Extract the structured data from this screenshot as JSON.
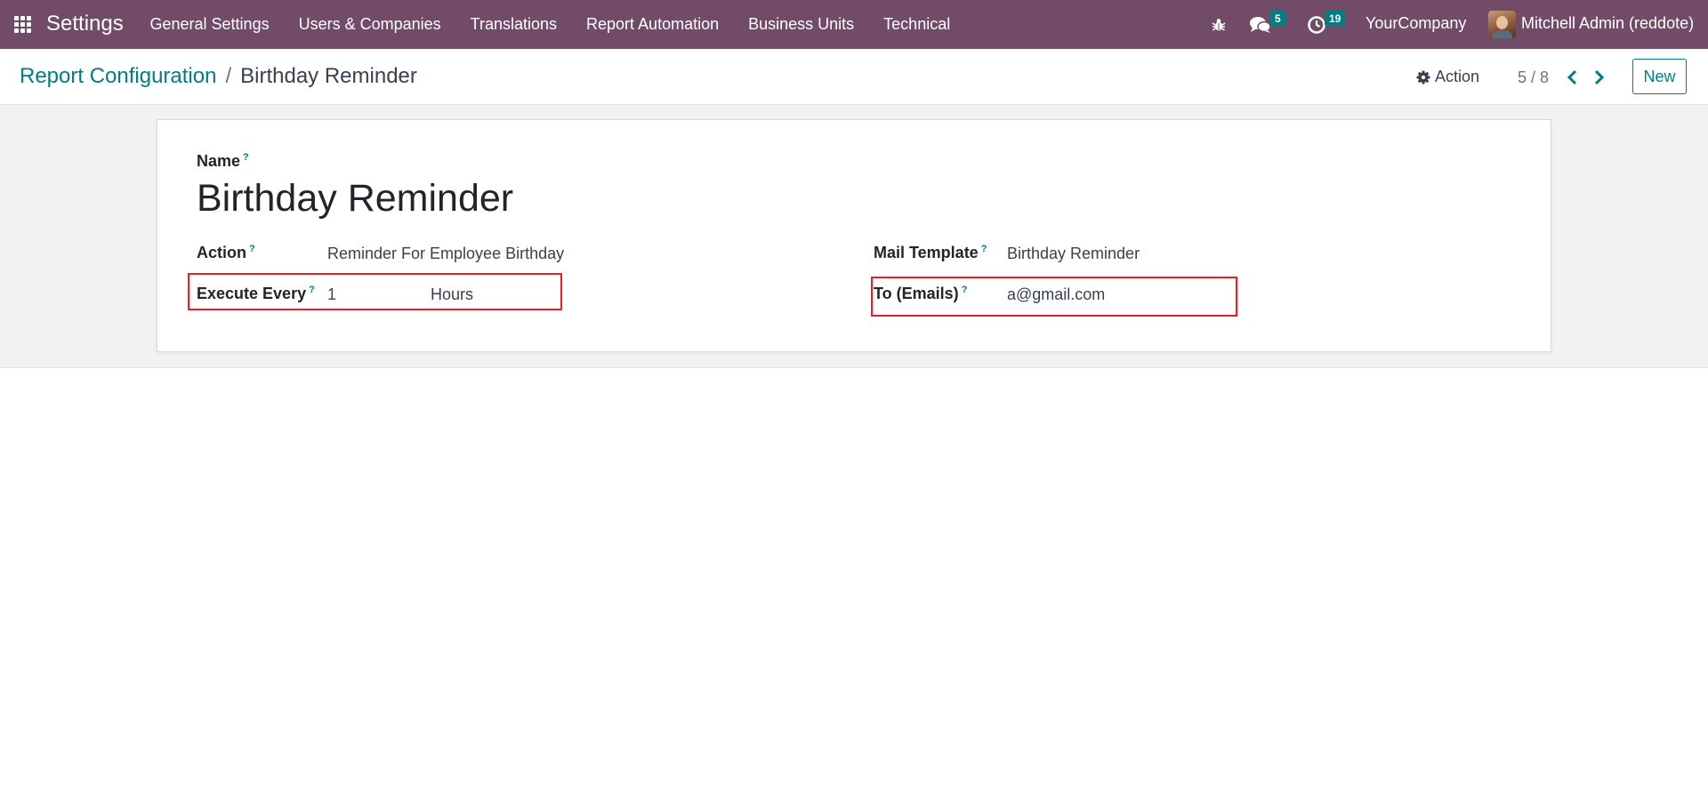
{
  "navbar": {
    "app_name": "Settings",
    "menu": [
      {
        "label": "General Settings"
      },
      {
        "label": "Users & Companies"
      },
      {
        "label": "Translations"
      },
      {
        "label": "Report Automation"
      },
      {
        "label": "Business Units"
      },
      {
        "label": "Technical"
      }
    ],
    "messages_count": "5",
    "activities_count": "19",
    "company": "YourCompany",
    "user": "Mitchell Admin (reddote)",
    "icons": [
      "apps-grid-icon",
      "bug-icon",
      "chat-icon",
      "clock-icon"
    ],
    "colors": {
      "navbar_bg": "#714b67",
      "badge_bg": "#017e84"
    }
  },
  "control_panel": {
    "breadcrumb_parent": "Report Configuration",
    "breadcrumb_separator": "/",
    "breadcrumb_current": "Birthday Reminder",
    "action_label": "Action",
    "pager": "5 / 8",
    "new_label": "New",
    "accent_color": "#017e84"
  },
  "form": {
    "name_label": "Name",
    "help_mark": "?",
    "name_value": "Birthday Reminder",
    "action_label": "Action",
    "action_value": "Reminder For Employee Birthday",
    "execute_every_label": "Execute Every",
    "execute_every_value": "1",
    "execute_every_unit": "Hours",
    "mail_template_label": "Mail Template",
    "mail_template_value": "Birthday Reminder",
    "to_emails_label": "To (Emails)",
    "to_emails_value": "a@gmail.com",
    "highlight_color": "#ee1c25"
  }
}
